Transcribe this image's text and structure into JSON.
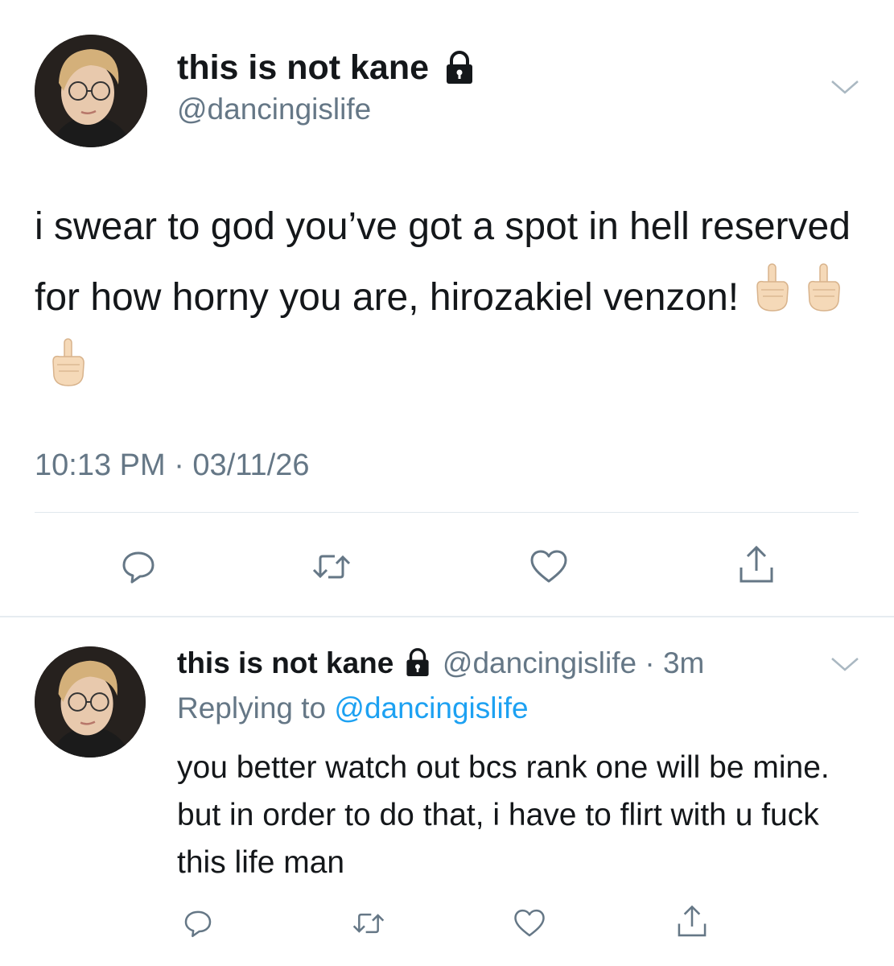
{
  "main_tweet": {
    "display_name": "this is not kane",
    "handle": "@dancingislife",
    "text": "i swear to god you’ve got a spot in hell reserved for how horny you are, hirozakiel venzon!",
    "emoji": [
      "middle-finger-emoji",
      "middle-finger-emoji",
      "middle-finger-emoji"
    ],
    "timestamp": "10:13 PM · 03/11/26",
    "lock_icon": "lock-icon",
    "actions": [
      "reply-icon",
      "retweet-icon",
      "like-icon",
      "share-icon"
    ]
  },
  "reply_tweet": {
    "display_name": "this is not kane",
    "handle": "@dancingislife",
    "age": "· 3m",
    "replying_prefix": "Replying to",
    "replying_handle": "@dancingislife",
    "text": "you better watch out bcs rank one will be mine. but in order to do that, i have to flirt with u fuck this life man",
    "actions": [
      "reply-icon",
      "retweet-icon",
      "like-icon",
      "share-icon"
    ]
  },
  "colors": {
    "text": "#14171a",
    "secondary": "#657786",
    "link": "#1da1f2",
    "divider": "#e1e8ed"
  }
}
